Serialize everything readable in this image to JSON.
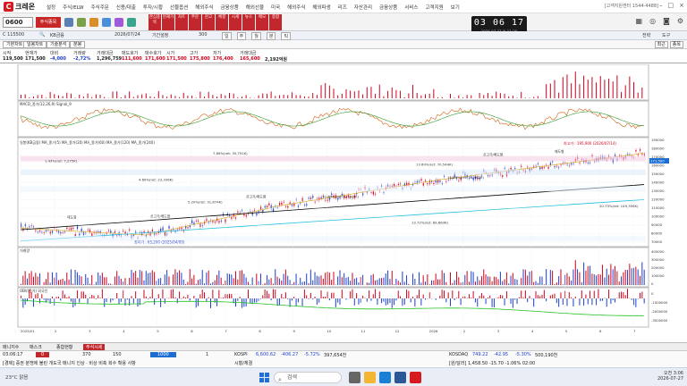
{
  "app": {
    "title": "크레온",
    "custinfo": "[고객지원센터 1544-4488]"
  },
  "menu": [
    "설정",
    "주식/ELW",
    "주식주문",
    "신용/대출",
    "투자/시황",
    "선물옵션",
    "해외주식",
    "금융상품",
    "해외선물",
    "미국",
    "해외주식",
    "해외파생",
    "리즈",
    "자산관리",
    "금융상품",
    "서비스",
    "고객지원",
    "보기"
  ],
  "toolbar": {
    "account": "0600",
    "acct_select": "주식종목",
    "clock": "03 06 17",
    "clock_date": "2026.07.27 월 11:30",
    "red_buttons": [
      "관심종목",
      "현재가",
      "차트",
      "주문",
      "잔고",
      "체결",
      "시세",
      "뉴스",
      "메모",
      "종합"
    ]
  },
  "controls": {
    "code": "C 115500",
    "name": "KB금융",
    "date": "2026/07/24",
    "period": "기간설정",
    "days": "300",
    "right": [
      "전략",
      "도구"
    ],
    "fast": [
      "일",
      "주",
      "월",
      "분",
      "틱"
    ]
  },
  "tabs": [
    "기본차트",
    "일봉차트",
    "기술분석",
    "분봉"
  ],
  "right_tabs": [
    "최근",
    "종목"
  ],
  "quote": {
    "headers": [
      "시작",
      "현재가",
      "대비",
      "거래량",
      "거래대금",
      "매도호가",
      "매수호가",
      "시가",
      "고가",
      "저가",
      "거래대금"
    ],
    "values": [
      "119,500",
      "171,500",
      "-4,000",
      "-2,72%",
      "1,296,759",
      "111,600",
      "171,600",
      "171,500",
      "175,800",
      "176,400",
      "165,600"
    ],
    "extra": "2,192억원"
  },
  "chart": {
    "ma_label": "일봉(KB금융) MA_종가(5) MA_종가(20) MA_종가(60) MA_종가(120) MA_종가(240)",
    "osc_label": "MACD_종가(12,26,9)  Signal_9",
    "vol_label": "거래량",
    "obv_label": "OBV(종가)  외국인",
    "high_note": "최고가 : 195,900 (2026/07/14)",
    "low_note": "최저가 : 65,200 (2025/04/09)",
    "annotations": [
      "매도형",
      "신고가/매도형",
      "매도형",
      "신고가/매도형",
      "신고가/매도형",
      "1.43%(ret: 7,275K)",
      "7.69%(ret: 35,791K)",
      "13.60%(ret: 70,544K)",
      "14.69%(ret: 76,902K)",
      "4.60%(ret: 23,336K)",
      "10.60%(ret: 54,201K)",
      "5.20%(ret: 31,874K)",
      "13.72%(ret: 69,663K)",
      "20.73%(ret: 149,356K)"
    ],
    "date_axis": [
      "2025/01",
      "2",
      "3",
      "4",
      "5",
      "6",
      "7",
      "8",
      "9",
      "10",
      "11",
      "12",
      "2026",
      "2",
      "3",
      "4",
      "5",
      "6",
      "7"
    ],
    "right_axis": [
      "190000",
      "180000",
      "170000",
      "160000",
      "150000",
      "140000",
      "130000",
      "120000",
      "110000",
      "100000",
      "90000",
      "80000",
      "70000"
    ],
    "last_price_label": "171,500",
    "vol_right": [
      "400000",
      "300000",
      "200000",
      "100000",
      "0"
    ],
    "obv_right": [
      "0",
      "-1000000",
      "-2000000",
      "-3000000"
    ]
  },
  "bottom": {
    "tabs": [
      "매니지수",
      "매스크",
      "종합현황",
      "주식시세"
    ],
    "rows": [
      [
        "03:06:17",
        "0",
        "370",
        "150",
        "1000",
        "1"
      ],
      [
        "KOSPI",
        "6,600.62",
        "-406.27",
        "-5.72%",
        "397,654천"
      ],
      [
        "KOSDAQ",
        "749.22",
        "-42.95",
        "-5.30%",
        "500,190천"
      ]
    ],
    "news": "[경제] 증권 분쟁에 불린 개도국 매니지 인상 · 비상 비축 회수 확용 사항",
    "mkt": [
      "시황/체결",
      "[원/달러] 1,458.50 -15.70 -1.06% 02:00"
    ]
  },
  "taskbar": {
    "search": "검색",
    "time": "오전 3:06",
    "date": "2026-07-27",
    "weather": "23°C 맑음"
  },
  "colors": {
    "up": "#d0021b",
    "down": "#1c3fd0",
    "accent": "#c2272d"
  }
}
